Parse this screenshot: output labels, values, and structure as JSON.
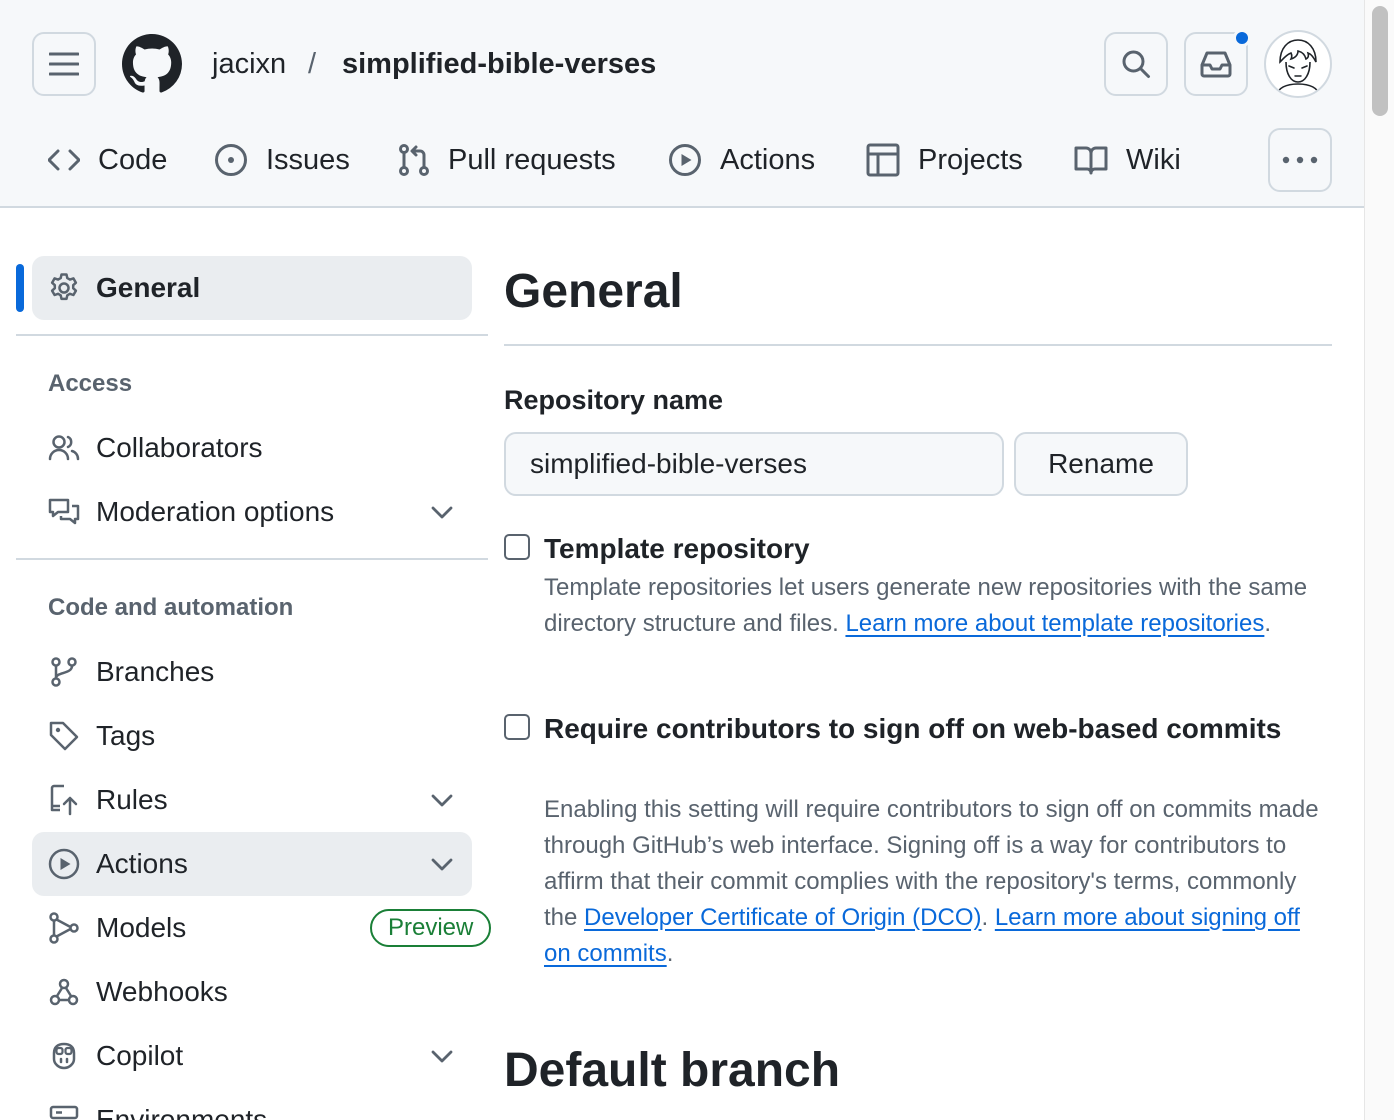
{
  "header": {
    "owner": "jacixn",
    "separator": "/",
    "repo": "simplified-bible-verses"
  },
  "tabs": [
    {
      "label": "Code",
      "icon": "code-icon"
    },
    {
      "label": "Issues",
      "icon": "issue-icon"
    },
    {
      "label": "Pull requests",
      "icon": "pull-request-icon"
    },
    {
      "label": "Actions",
      "icon": "play-icon"
    },
    {
      "label": "Projects",
      "icon": "table-icon"
    },
    {
      "label": "Wiki",
      "icon": "book-icon"
    }
  ],
  "sidebar": {
    "general": "General",
    "access_heading": "Access",
    "access_items": [
      {
        "label": "Collaborators",
        "icon": "people-icon"
      },
      {
        "label": "Moderation options",
        "icon": "comment-discussion-icon"
      }
    ],
    "code_heading": "Code and automation",
    "code_items": [
      {
        "label": "Branches",
        "icon": "git-branch-icon"
      },
      {
        "label": "Tags",
        "icon": "tag-icon"
      },
      {
        "label": "Rules",
        "icon": "repo-push-icon"
      },
      {
        "label": "Actions",
        "icon": "play-icon"
      },
      {
        "label": "Models",
        "icon": "workflow-icon",
        "badge": "Preview"
      },
      {
        "label": "Webhooks",
        "icon": "webhook-icon"
      },
      {
        "label": "Copilot",
        "icon": "copilot-icon"
      },
      {
        "label": "Environments",
        "icon": "server-icon"
      }
    ]
  },
  "main": {
    "title": "General",
    "repo_name_label": "Repository name",
    "repo_name_value": "simplified-bible-verses",
    "rename_label": "Rename",
    "template": {
      "label": "Template repository",
      "desc_text": "Template repositories let users generate new repositories with the same directory structure and files. ",
      "link": "Learn more about template repositories",
      "trailing": "."
    },
    "signoff": {
      "label": "Require contributors to sign off on web-based commits",
      "desc_text": "Enabling this setting will require contributors to sign off on commits made through GitHub’s web interface. Signing off is a way for contributors to affirm that their commit complies with the repository's terms, commonly the ",
      "link1": "Developer Certificate of Origin (DCO)",
      "mid": ". ",
      "link2": "Learn more about signing off on commits",
      "trailing": "."
    },
    "default_branch_title": "Default branch"
  },
  "colors": {
    "accent": "#0969da",
    "success": "#1a7f37",
    "muted": "#59636e",
    "border": "#d1d9e0"
  }
}
